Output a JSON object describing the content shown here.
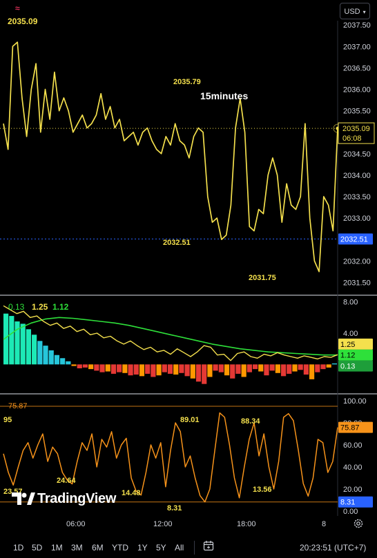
{
  "header": {
    "currency": "USD",
    "last_price": "2035.09",
    "timeframe_label": "15minutes"
  },
  "branding": {
    "logo_text": "TradingView"
  },
  "toolbar": {
    "ranges": [
      "1D",
      "5D",
      "1M",
      "3M",
      "6M",
      "YTD",
      "1Y",
      "5Y",
      "All"
    ],
    "clock": "20:23:51 (UTC+7)"
  },
  "colors": {
    "price_line": "#f4e04d",
    "rsi_line": "#f7931a",
    "ema_line": "#2ee03a",
    "macd_line": "#f4e04d",
    "hist_pos": "#26c6da",
    "hist_pos_strong": "#1de9b6",
    "hist_neg": "#e53935",
    "hist_neg_light": "#ff9800",
    "current_price_tag": "#f4e04d",
    "low_tag": "#2962ff"
  },
  "chart_data": [
    {
      "type": "line",
      "name": "price",
      "x_ticks": [
        "06:00",
        "12:00",
        "18:00",
        "8"
      ],
      "y_ticks": [
        "2031.50",
        "2032.00",
        "2032.50",
        "2033.00",
        "2033.50",
        "2034.00",
        "2034.50",
        "2035.00",
        "2035.50",
        "2036.00",
        "2036.50",
        "2037.00",
        "2037.50"
      ],
      "ylim": [
        2031.2,
        2037.6
      ],
      "values": [
        2035.2,
        2034.6,
        2037.0,
        2037.1,
        2035.8,
        2034.9,
        2036.0,
        2036.6,
        2035.0,
        2036.0,
        2035.3,
        2036.4,
        2035.5,
        2035.8,
        2035.5,
        2035.0,
        2035.2,
        2035.4,
        2035.1,
        2035.2,
        2035.4,
        2035.9,
        2035.3,
        2035.6,
        2035.1,
        2035.3,
        2034.8,
        2034.9,
        2035.0,
        2034.7,
        2035.0,
        2035.1,
        2034.8,
        2034.6,
        2034.5,
        2034.9,
        2034.7,
        2035.2,
        2034.8,
        2034.7,
        2034.4,
        2034.9,
        2035.1,
        2035.0,
        2033.5,
        2032.9,
        2033.0,
        2032.5,
        2032.6,
        2033.3,
        2035.1,
        2035.79,
        2035.0,
        2032.8,
        2032.7,
        2033.2,
        2033.1,
        2034.0,
        2034.4,
        2034.0,
        2032.9,
        2033.8,
        2033.3,
        2033.2,
        2033.5,
        2035.2,
        2033.0,
        2032.0,
        2031.75,
        2033.5,
        2033.3,
        2032.7,
        2035.09
      ],
      "annotations": [
        {
          "label": "2035.79",
          "value": 2035.79
        },
        {
          "label": "2032.51",
          "value": 2032.51
        },
        {
          "label": "2031.75",
          "value": 2031.75
        }
      ],
      "price_tags": [
        {
          "label": "2035.09",
          "sub": "06:08",
          "value": 2035.09
        },
        {
          "label": "2032.51",
          "value": 2032.51
        }
      ]
    },
    {
      "type": "line",
      "name": "macd",
      "legend": [
        "0.13",
        "1.25",
        "1.12"
      ],
      "y_ticks": [
        "8.00",
        "4.00"
      ],
      "ylim": [
        -3.5,
        8.5
      ],
      "ema_values": [
        3.2,
        4.5,
        5.3,
        5.8,
        6.0,
        5.9,
        5.7,
        5.5,
        5.3,
        5.0,
        4.6,
        4.2,
        3.8,
        3.4,
        3.0,
        2.6,
        2.3,
        2.0,
        1.8,
        1.6,
        1.5,
        1.4,
        1.3,
        1.2,
        1.2
      ],
      "macd_values": [
        7.5,
        7.0,
        6.5,
        6.8,
        6.0,
        6.2,
        5.5,
        5.0,
        5.3,
        4.6,
        4.9,
        4.2,
        4.5,
        3.8,
        4.0,
        3.4,
        3.6,
        3.0,
        2.6,
        3.0,
        2.4,
        1.9,
        2.2,
        1.6,
        1.8,
        1.3,
        2.0,
        1.5,
        1.0,
        1.6,
        2.4,
        2.2,
        1.2,
        1.3,
        0.5,
        1.4,
        1.6,
        1.0,
        0.8,
        1.3,
        1.1,
        1.5,
        1.2,
        1.0,
        0.8,
        1.1,
        0.9,
        0.7,
        1.0,
        0.9,
        1.25
      ],
      "hist_values": [
        6.5,
        6.2,
        5.5,
        5.2,
        4.5,
        3.8,
        3.0,
        2.4,
        1.8,
        1.2,
        0.8,
        0.4,
        -0.2,
        -0.5,
        -0.4,
        -0.6,
        -0.8,
        -1.0,
        -0.9,
        -1.2,
        -1.0,
        -1.1,
        -1.4,
        -1.3,
        -1.5,
        -1.2,
        -1.6,
        -1.4,
        -1.0,
        -1.2,
        -1.3,
        -1.1,
        -1.5,
        -1.8,
        -2.2,
        -2.5,
        -1.6,
        -0.8,
        -1.0,
        -1.4,
        -1.8,
        -1.2,
        -1.6,
        -1.0,
        -0.6,
        -0.9,
        -1.4,
        -0.8,
        -1.1,
        -1.5,
        -1.2,
        -0.9,
        -0.7,
        -1.3,
        -1.9,
        -1.0,
        -0.6,
        -0.4,
        0.13
      ],
      "price_tags": [
        {
          "label": "1.25",
          "value": 1.25
        },
        {
          "label": "1.12",
          "value": 1.12
        },
        {
          "label": "0.13",
          "value": 0.13
        }
      ]
    },
    {
      "type": "line",
      "name": "rsi",
      "legend": [
        "75.87"
      ],
      "y_ticks": [
        "100.00",
        "80.00",
        "60.00",
        "40.00",
        "20.00",
        "0.00"
      ],
      "ylim": [
        0,
        100
      ],
      "values": [
        52,
        35,
        23.57,
        40,
        55,
        62,
        48,
        60,
        70,
        45,
        58,
        52,
        35,
        28,
        24.64,
        45,
        62,
        55,
        70,
        40,
        65,
        58,
        72,
        48,
        60,
        66,
        30,
        18,
        14.48,
        35,
        60,
        48,
        62,
        22,
        55,
        80,
        72,
        40,
        50,
        30,
        14,
        8.31,
        20,
        55,
        89.01,
        85,
        60,
        30,
        12,
        40,
        65,
        80,
        50,
        70,
        40,
        20,
        45,
        85,
        88.34,
        82,
        55,
        25,
        13.56,
        30,
        65,
        62,
        35,
        45,
        75.87
      ],
      "annotations": [
        {
          "label": "95",
          "value": 95
        },
        {
          "label": "23.57",
          "value": 23.57
        },
        {
          "label": "24.64",
          "value": 24.64
        },
        {
          "label": "14.48",
          "value": 14.48
        },
        {
          "label": "8.31",
          "value": 8.31
        },
        {
          "label": "89.01",
          "value": 89.01
        },
        {
          "label": "88.34",
          "value": 88.34
        },
        {
          "label": "13.56",
          "value": 13.56
        }
      ],
      "price_tags": [
        {
          "label": "75.87",
          "value": 75.87
        },
        {
          "label": "8.31",
          "value": 8.31
        }
      ]
    }
  ]
}
